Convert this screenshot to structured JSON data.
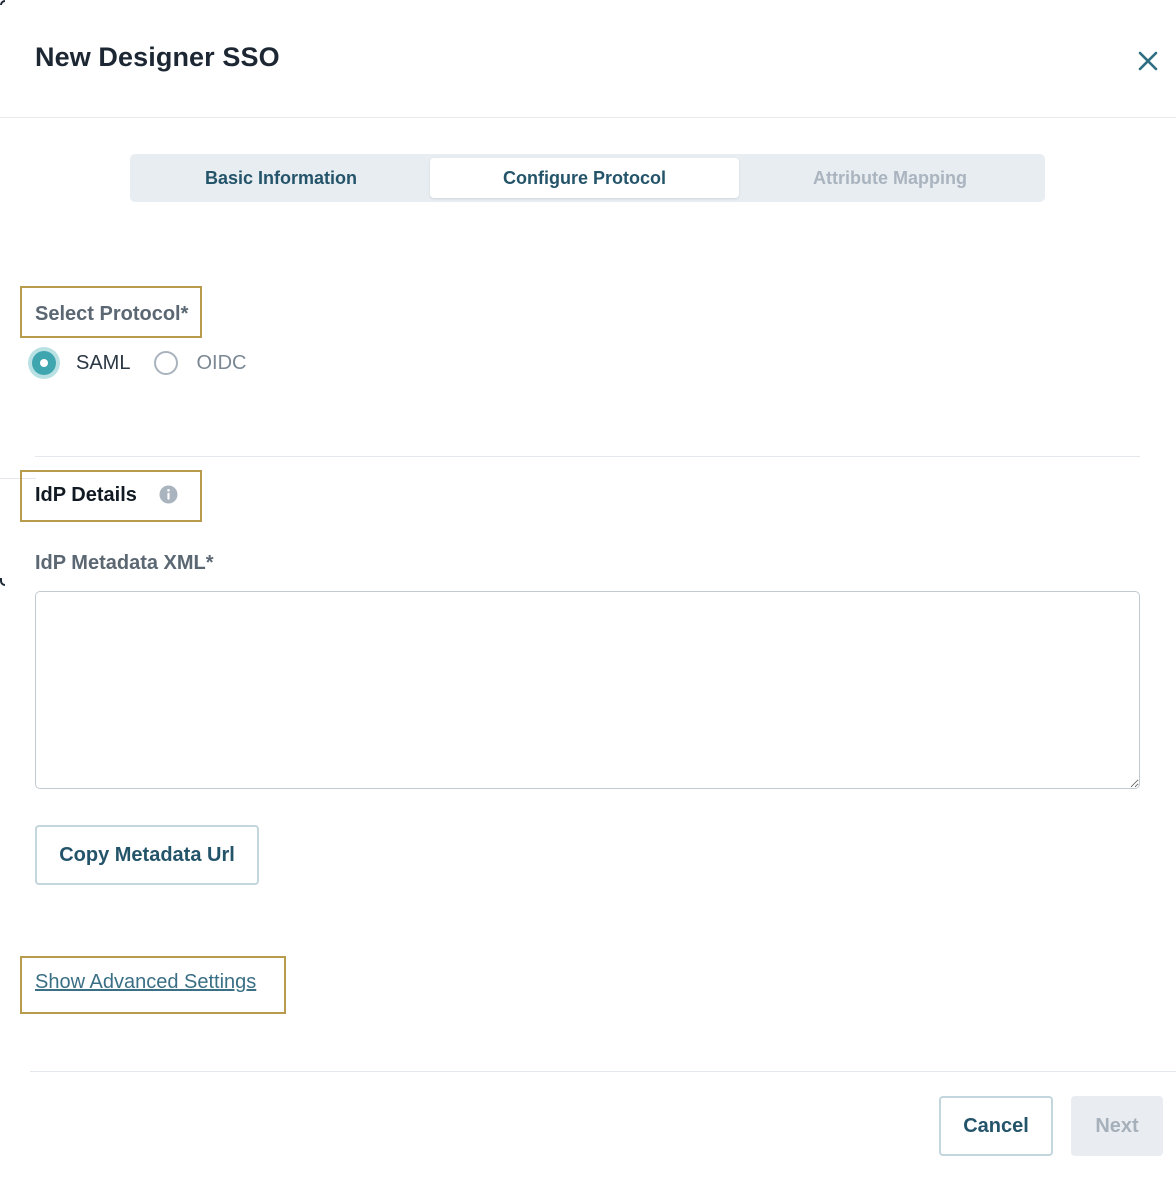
{
  "dialog": {
    "title": "New Designer SSO"
  },
  "stepper": {
    "steps": [
      {
        "label": "Basic Information",
        "state": "completed"
      },
      {
        "label": "Configure Protocol",
        "state": "active"
      },
      {
        "label": "Attribute Mapping",
        "state": "disabled"
      }
    ]
  },
  "protocol": {
    "label": "Select Protocol*",
    "options": [
      {
        "label": "SAML",
        "selected": true
      },
      {
        "label": "OIDC",
        "selected": false
      }
    ]
  },
  "idp": {
    "section_title": "IdP Details",
    "metadata_label": "IdP Metadata XML*",
    "metadata_value": "",
    "copy_button": "Copy Metadata Url"
  },
  "advanced": {
    "link_label": "Show Advanced Settings"
  },
  "footer": {
    "cancel_label": "Cancel",
    "next_label": "Next"
  },
  "colors": {
    "accent": "#3fa6b0",
    "primary_text": "#24546a",
    "highlight_border": "#b89b4c"
  }
}
